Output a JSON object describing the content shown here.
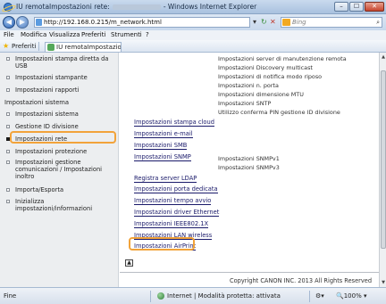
{
  "window": {
    "title_prefix": "IU remotaImpostazioni rete:",
    "title_suffix": "- Windows Internet Explorer",
    "minimize": "–",
    "maximize": "☐",
    "close": "✕"
  },
  "address": {
    "url": "http://192.168.0.215/m_network.html",
    "search_placeholder": "Bing"
  },
  "menu": [
    "File",
    "Modifica",
    "Visualizza",
    "Preferiti",
    "Strumenti",
    "?"
  ],
  "favorites": {
    "label": "Preferiti",
    "tab_title": "IU remotaImpostazioni rete:"
  },
  "sidebar": {
    "items_top": [
      "Impostazioni stampa diretta da USB",
      "Impostazioni stampante",
      "Impostazioni rapporti"
    ],
    "section": "Impostazioni sistema",
    "items": [
      "Impostazioni sistema",
      "Gestione ID divisione",
      "Impostazioni rete",
      "Impostazioni protezione",
      "Impostazioni gestione comunicazioni / Impostazioni inoltro",
      "Importa/Esporta",
      "Inizializza impostazioni/informazioni"
    ]
  },
  "main": {
    "top_list": [
      "Impostazioni server di manutenzione remota",
      "Impostazioni Discovery multicast",
      "Impostazioni di notifica modo riposo",
      "Impostazioni n. porta",
      "Impostazioni dimensione MTU",
      "Impostazioni SNTP",
      "Utilizzo conferma PIN gestione ID divisione"
    ],
    "links": [
      "Impostazioni stampa cloud",
      "Impostazioni e-mail",
      "Impostazioni SMB",
      "Impostazioni SNMP",
      "Registra server LDAP",
      "Impostazioni porta dedicata",
      "Impostazioni tempo avvio",
      "Impostazioni driver Ethernet",
      "Impostazioni IEEE802.1X",
      "Impostazioni LAN wireless",
      "Impostazioni AirPrint"
    ],
    "snmp_sub": [
      "Impostazioni SNMPv1",
      "Impostazioni SNMPv3"
    ],
    "top_button": "▲",
    "copyright": "Copyright CANON INC. 2013 All Rights Reserved"
  },
  "status": {
    "left": "Fine",
    "zone": "Internet | Modalità protetta: attivata",
    "zoom": "100%"
  },
  "colors": {
    "highlight": "#f2a33a",
    "link": "#1a1a6a"
  }
}
